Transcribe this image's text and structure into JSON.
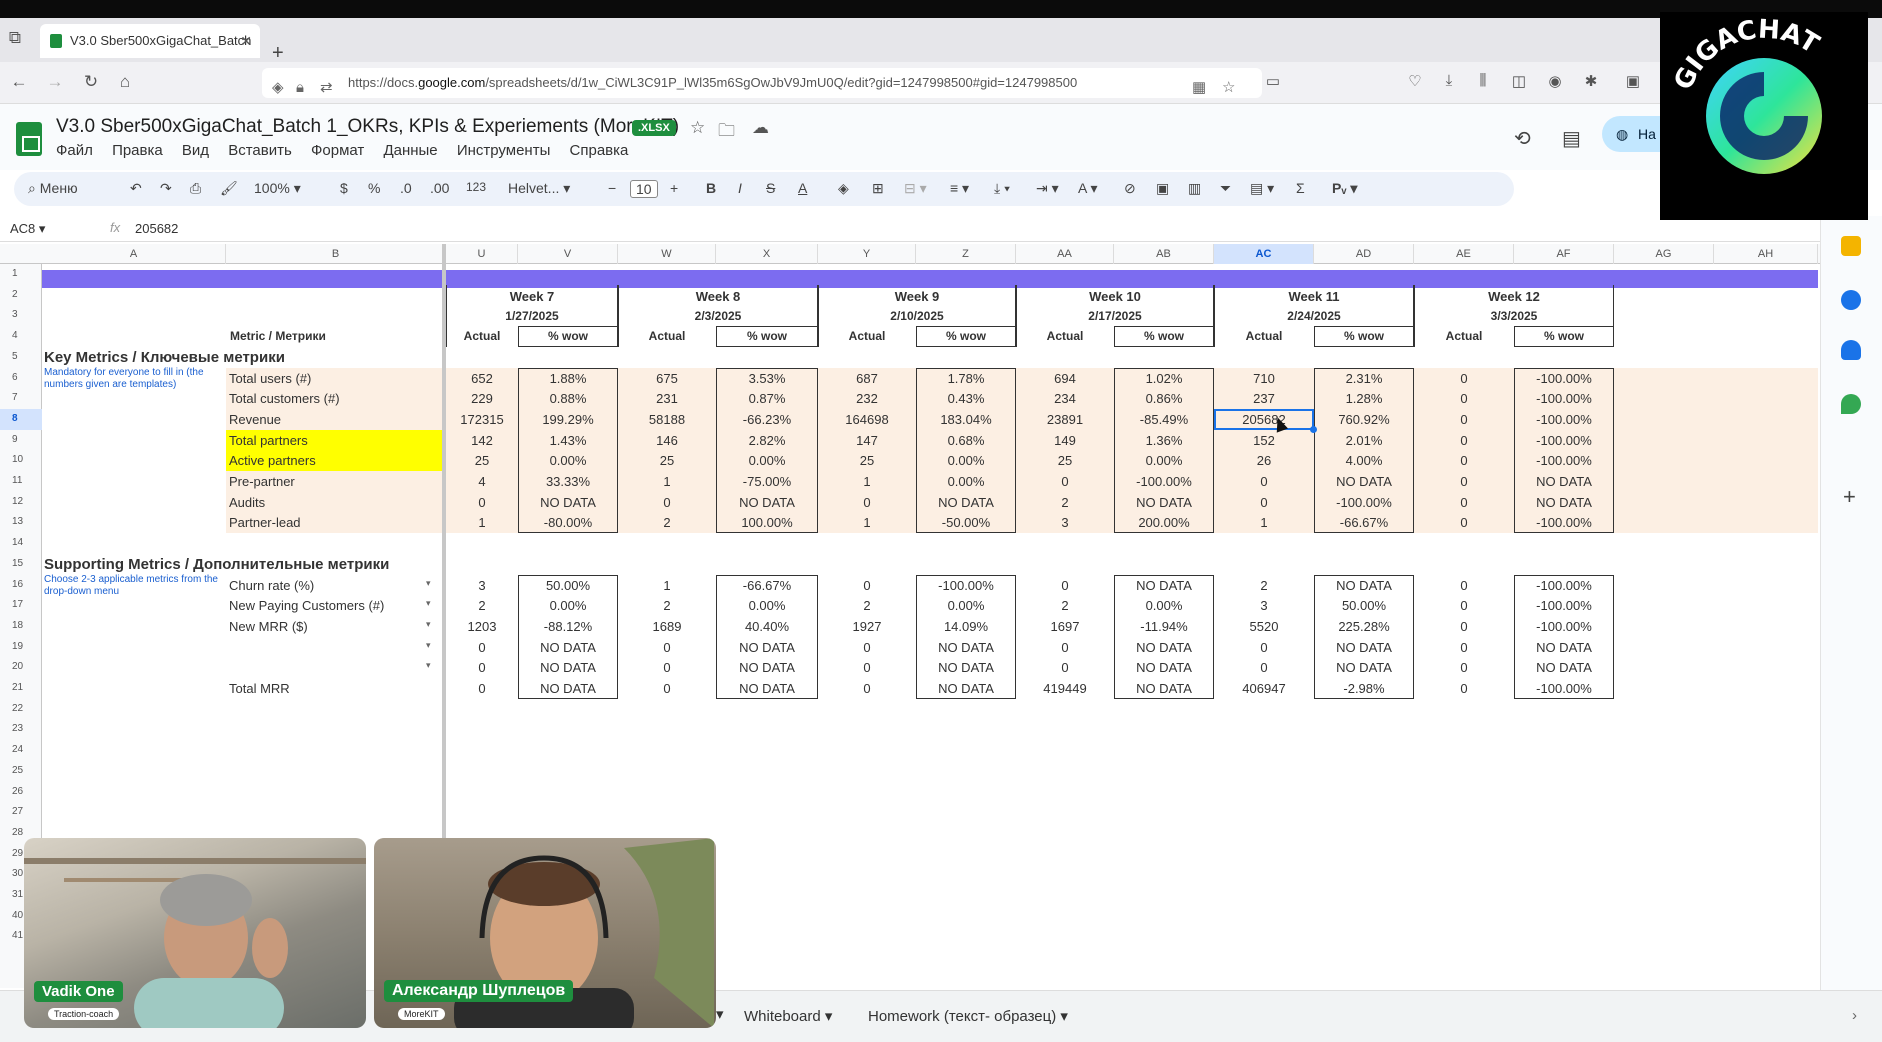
{
  "browser": {
    "tab_title": "V3.0 Sber500xGigaChat_Batch",
    "url_prefix": "https://docs.",
    "url_domain": "google.com",
    "url_rest": "/spreadsheets/d/1w_CiWL3C91P_lWl35m6SgOwJbV9JmU0Q/edit?gid=1247998500#gid=1247998500"
  },
  "doc": {
    "title": "V3.0 Sber500xGigaChat_Batch 1_OKRs, KPIs & Experiements (MoreKIT)",
    "badge": ".XLSX",
    "menus": [
      "Файл",
      "Правка",
      "Вид",
      "Вставить",
      "Формат",
      "Данные",
      "Инструменты",
      "Справка"
    ],
    "share_label": "На"
  },
  "toolbar": {
    "search": "Меню",
    "zoom": "100%",
    "currency": "$",
    "percent": "%",
    "dec_less": ".0",
    "dec_more": ".00",
    "num_format": "123",
    "font": "Helvet...",
    "font_size": "10"
  },
  "formula_bar": {
    "cell_ref": "AC8",
    "value": "205682"
  },
  "columns": [
    "A",
    "B",
    "U",
    "V",
    "W",
    "X",
    "Y",
    "Z",
    "AA",
    "AB",
    "AC",
    "AD",
    "AE",
    "AF",
    "AG",
    "AH"
  ],
  "selected_column": "AC",
  "row_numbers": [
    "1",
    "2",
    "3",
    "4",
    "5",
    "6",
    "7",
    "8",
    "9",
    "10",
    "11",
    "12",
    "13",
    "14",
    "15",
    "16",
    "17",
    "18",
    "19",
    "20",
    "21",
    "22",
    "23",
    "24",
    "25",
    "26",
    "27",
    "28",
    "29",
    "30",
    "31",
    "40",
    "41"
  ],
  "selected_row": "8",
  "sheet": {
    "metric_header": "Metric / Метрики",
    "actual_label": "Actual",
    "wow_label": "% wow",
    "weeks": [
      {
        "name": "Week 7",
        "date": "1/27/2025"
      },
      {
        "name": "Week 8",
        "date": "2/3/2025"
      },
      {
        "name": "Week 9",
        "date": "2/10/2025"
      },
      {
        "name": "Week 10",
        "date": "2/17/2025"
      },
      {
        "name": "Week 11",
        "date": "2/24/2025"
      },
      {
        "name": "Week 12",
        "date": "3/3/2025"
      }
    ],
    "key_section": {
      "title": "Key Metrics / Ключевые метрики",
      "note": "Mandatory for everyone to fill in (the numbers given are templates)",
      "rows": [
        {
          "label": "Total users (#)",
          "cells": [
            "652",
            "1.88%",
            "675",
            "3.53%",
            "687",
            "1.78%",
            "694",
            "1.02%",
            "710",
            "2.31%",
            "0",
            "-100.00%"
          ]
        },
        {
          "label": "Total customers (#)",
          "cells": [
            "229",
            "0.88%",
            "231",
            "0.87%",
            "232",
            "0.43%",
            "234",
            "0.86%",
            "237",
            "1.28%",
            "0",
            "-100.00%"
          ]
        },
        {
          "label": "Revenue",
          "cells": [
            "172315",
            "199.29%",
            "58188",
            "-66.23%",
            "164698",
            "183.04%",
            "23891",
            "-85.49%",
            "205682",
            "760.92%",
            "0",
            "-100.00%"
          ]
        },
        {
          "label": "Total partners",
          "cells": [
            "142",
            "1.43%",
            "146",
            "2.82%",
            "147",
            "0.68%",
            "149",
            "1.36%",
            "152",
            "2.01%",
            "0",
            "-100.00%"
          ]
        },
        {
          "label": "Active partners",
          "cells": [
            "25",
            "0.00%",
            "25",
            "0.00%",
            "25",
            "0.00%",
            "25",
            "0.00%",
            "26",
            "4.00%",
            "0",
            "-100.00%"
          ]
        },
        {
          "label": "Pre-partner",
          "cells": [
            "4",
            "33.33%",
            "1",
            "-75.00%",
            "1",
            "0.00%",
            "0",
            "-100.00%",
            "0",
            "NO DATA",
            "0",
            "NO DATA"
          ]
        },
        {
          "label": "Audits",
          "cells": [
            "0",
            "NO DATA",
            "0",
            "NO DATA",
            "0",
            "NO DATA",
            "2",
            "NO DATA",
            "0",
            "-100.00%",
            "0",
            "NO DATA"
          ]
        },
        {
          "label": "Partner-lead",
          "cells": [
            "1",
            "-80.00%",
            "2",
            "100.00%",
            "1",
            "-50.00%",
            "3",
            "200.00%",
            "1",
            "-66.67%",
            "0",
            "-100.00%"
          ]
        }
      ]
    },
    "support_section": {
      "title": "Supporting Metrics / Дополнительные метрики",
      "note": "Choose 2-3 applicable metrics from the drop-down menu",
      "rows": [
        {
          "label": "Churn rate (%)",
          "cells": [
            "3",
            "50.00%",
            "1",
            "-66.67%",
            "0",
            "-100.00%",
            "0",
            "NO DATA",
            "2",
            "NO DATA",
            "0",
            "-100.00%"
          ]
        },
        {
          "label": "New Paying Customers (#)",
          "cells": [
            "2",
            "0.00%",
            "2",
            "0.00%",
            "2",
            "0.00%",
            "2",
            "0.00%",
            "3",
            "50.00%",
            "0",
            "-100.00%"
          ]
        },
        {
          "label": "New MRR ($)",
          "cells": [
            "1203",
            "-88.12%",
            "1689",
            "40.40%",
            "1927",
            "14.09%",
            "1697",
            "-11.94%",
            "5520",
            "225.28%",
            "0",
            "-100.00%"
          ]
        },
        {
          "label": "",
          "cells": [
            "0",
            "NO DATA",
            "0",
            "NO DATA",
            "0",
            "NO DATA",
            "0",
            "NO DATA",
            "0",
            "NO DATA",
            "0",
            "NO DATA"
          ]
        },
        {
          "label": "",
          "cells": [
            "0",
            "NO DATA",
            "0",
            "NO DATA",
            "0",
            "NO DATA",
            "0",
            "NO DATA",
            "0",
            "NO DATA",
            "0",
            "NO DATA"
          ]
        },
        {
          "label": "Total MRR",
          "cells": [
            "0",
            "NO DATA",
            "0",
            "NO DATA",
            "0",
            "NO DATA",
            "419449",
            "NO DATA",
            "406947",
            "-2.98%",
            "0",
            "-100.00%"
          ]
        }
      ]
    }
  },
  "sheet_tabs": [
    "Whiteboard",
    "Homework (текст- образец)"
  ],
  "participants": [
    {
      "name": "Vadik One",
      "role": "Traction-coach"
    },
    {
      "name": "Александр Шуплецов",
      "role": "MoreKIT"
    }
  ],
  "logo_text": "GIGACHAT"
}
